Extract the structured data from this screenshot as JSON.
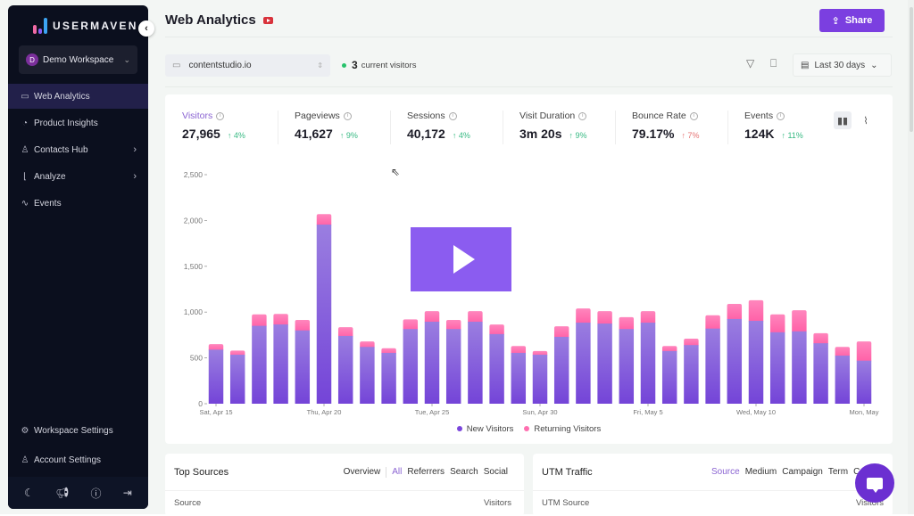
{
  "sidebar": {
    "logo_text": "USERMAVEN.",
    "workspace": {
      "initial": "D",
      "name": "Demo Workspace"
    },
    "items": [
      {
        "label": "Web Analytics",
        "icon": "browser-icon",
        "active": true
      },
      {
        "label": "Product Insights",
        "icon": "pie-clock-icon"
      },
      {
        "label": "Contacts Hub",
        "icon": "user-icon",
        "has_submenu": true
      },
      {
        "label": "Analyze",
        "icon": "chart-area-icon",
        "has_submenu": true
      },
      {
        "label": "Events",
        "icon": "pulse-icon"
      }
    ],
    "footer_items": [
      {
        "label": "Workspace Settings",
        "icon": "gear-icon"
      },
      {
        "label": "Account Settings",
        "icon": "user-settings-icon"
      }
    ],
    "bottom_icons": [
      "moon-icon",
      "megaphone-icon",
      "help-icon",
      "logout-icon"
    ]
  },
  "header": {
    "title": "Web Analytics",
    "share_label": "Share"
  },
  "toolbar": {
    "site": "contentstudio.io",
    "live_count": "3",
    "live_label": "current visitors",
    "date_range": "Last 30 days"
  },
  "metrics": [
    {
      "label": "Visitors",
      "value": "27,965",
      "delta": "↑ 4%",
      "trend": "up",
      "active": true
    },
    {
      "label": "Pageviews",
      "value": "41,627",
      "delta": "↑ 9%",
      "trend": "up"
    },
    {
      "label": "Sessions",
      "value": "40,172",
      "delta": "↑ 4%",
      "trend": "up"
    },
    {
      "label": "Visit Duration",
      "value": "3m 20s",
      "delta": "↑ 9%",
      "trend": "up"
    },
    {
      "label": "Bounce Rate",
      "value": "79.17%",
      "delta": "↑ 7%",
      "trend": "bad"
    },
    {
      "label": "Events",
      "value": "124K",
      "delta": "↑ 11%",
      "trend": "up"
    }
  ],
  "colors": {
    "accent": "#7b3fe0",
    "new_visitors": "#7a45dc",
    "returning_visitors": "#ff6fb0",
    "positive": "#36b982",
    "negative": "#e57373"
  },
  "chart_data": {
    "type": "bar",
    "stacked": true,
    "title": "",
    "xlabel": "",
    "ylabel": "",
    "ylim": [
      0,
      2500
    ],
    "yticks": [
      0,
      500,
      1000,
      1500,
      2000,
      2500
    ],
    "ytick_labels": [
      "0",
      "500",
      "1,000",
      "1,500",
      "2,000",
      "2,500"
    ],
    "xtick_labels": [
      {
        "index": 0,
        "label": "Sat, Apr 15"
      },
      {
        "index": 5,
        "label": "Thu, Apr 20"
      },
      {
        "index": 10,
        "label": "Tue, Apr 25"
      },
      {
        "index": 15,
        "label": "Sun, Apr 30"
      },
      {
        "index": 20,
        "label": "Fri, May 5"
      },
      {
        "index": 25,
        "label": "Wed, May 10"
      },
      {
        "index": 30,
        "label": "Mon, May"
      }
    ],
    "categories": [
      "Apr 15",
      "Apr 16",
      "Apr 17",
      "Apr 18",
      "Apr 19",
      "Apr 20",
      "Apr 21",
      "Apr 22",
      "Apr 23",
      "Apr 24",
      "Apr 25",
      "Apr 26",
      "Apr 27",
      "Apr 28",
      "Apr 29",
      "Apr 30",
      "May 1",
      "May 2",
      "May 3",
      "May 4",
      "May 5",
      "May 6",
      "May 7",
      "May 8",
      "May 9",
      "May 10",
      "May 11",
      "May 12",
      "May 13",
      "May 14",
      "May 15"
    ],
    "series": [
      {
        "name": "New Visitors",
        "values": [
          590,
          535,
          850,
          865,
          800,
          1955,
          740,
          620,
          555,
          815,
          895,
          815,
          895,
          760,
          555,
          535,
          730,
          885,
          875,
          815,
          885,
          575,
          640,
          820,
          925,
          905,
          780,
          790,
          660,
          525,
          470
        ]
      },
      {
        "name": "Returning Visitors",
        "values": [
          60,
          45,
          125,
          115,
          115,
          115,
          95,
          60,
          50,
          105,
          115,
          100,
          115,
          105,
          75,
          40,
          115,
          155,
          135,
          130,
          125,
          55,
          70,
          145,
          165,
          225,
          195,
          230,
          110,
          95,
          210
        ]
      }
    ],
    "legend": [
      "New Visitors",
      "Returning Visitors"
    ],
    "legend_position": "bottom",
    "grid": false
  },
  "top_sources": {
    "title": "Top Sources",
    "tabs": [
      "Overview",
      "All",
      "Referrers",
      "Search",
      "Social"
    ],
    "active_tab": "All",
    "col_source": "Source",
    "col_visitors": "Visitors"
  },
  "utm_traffic": {
    "title": "UTM Traffic",
    "tabs": [
      "Source",
      "Medium",
      "Campaign",
      "Term",
      "Co"
    ],
    "active_tab": "Source",
    "col_source": "UTM Source",
    "col_visitors": "Visitors"
  }
}
